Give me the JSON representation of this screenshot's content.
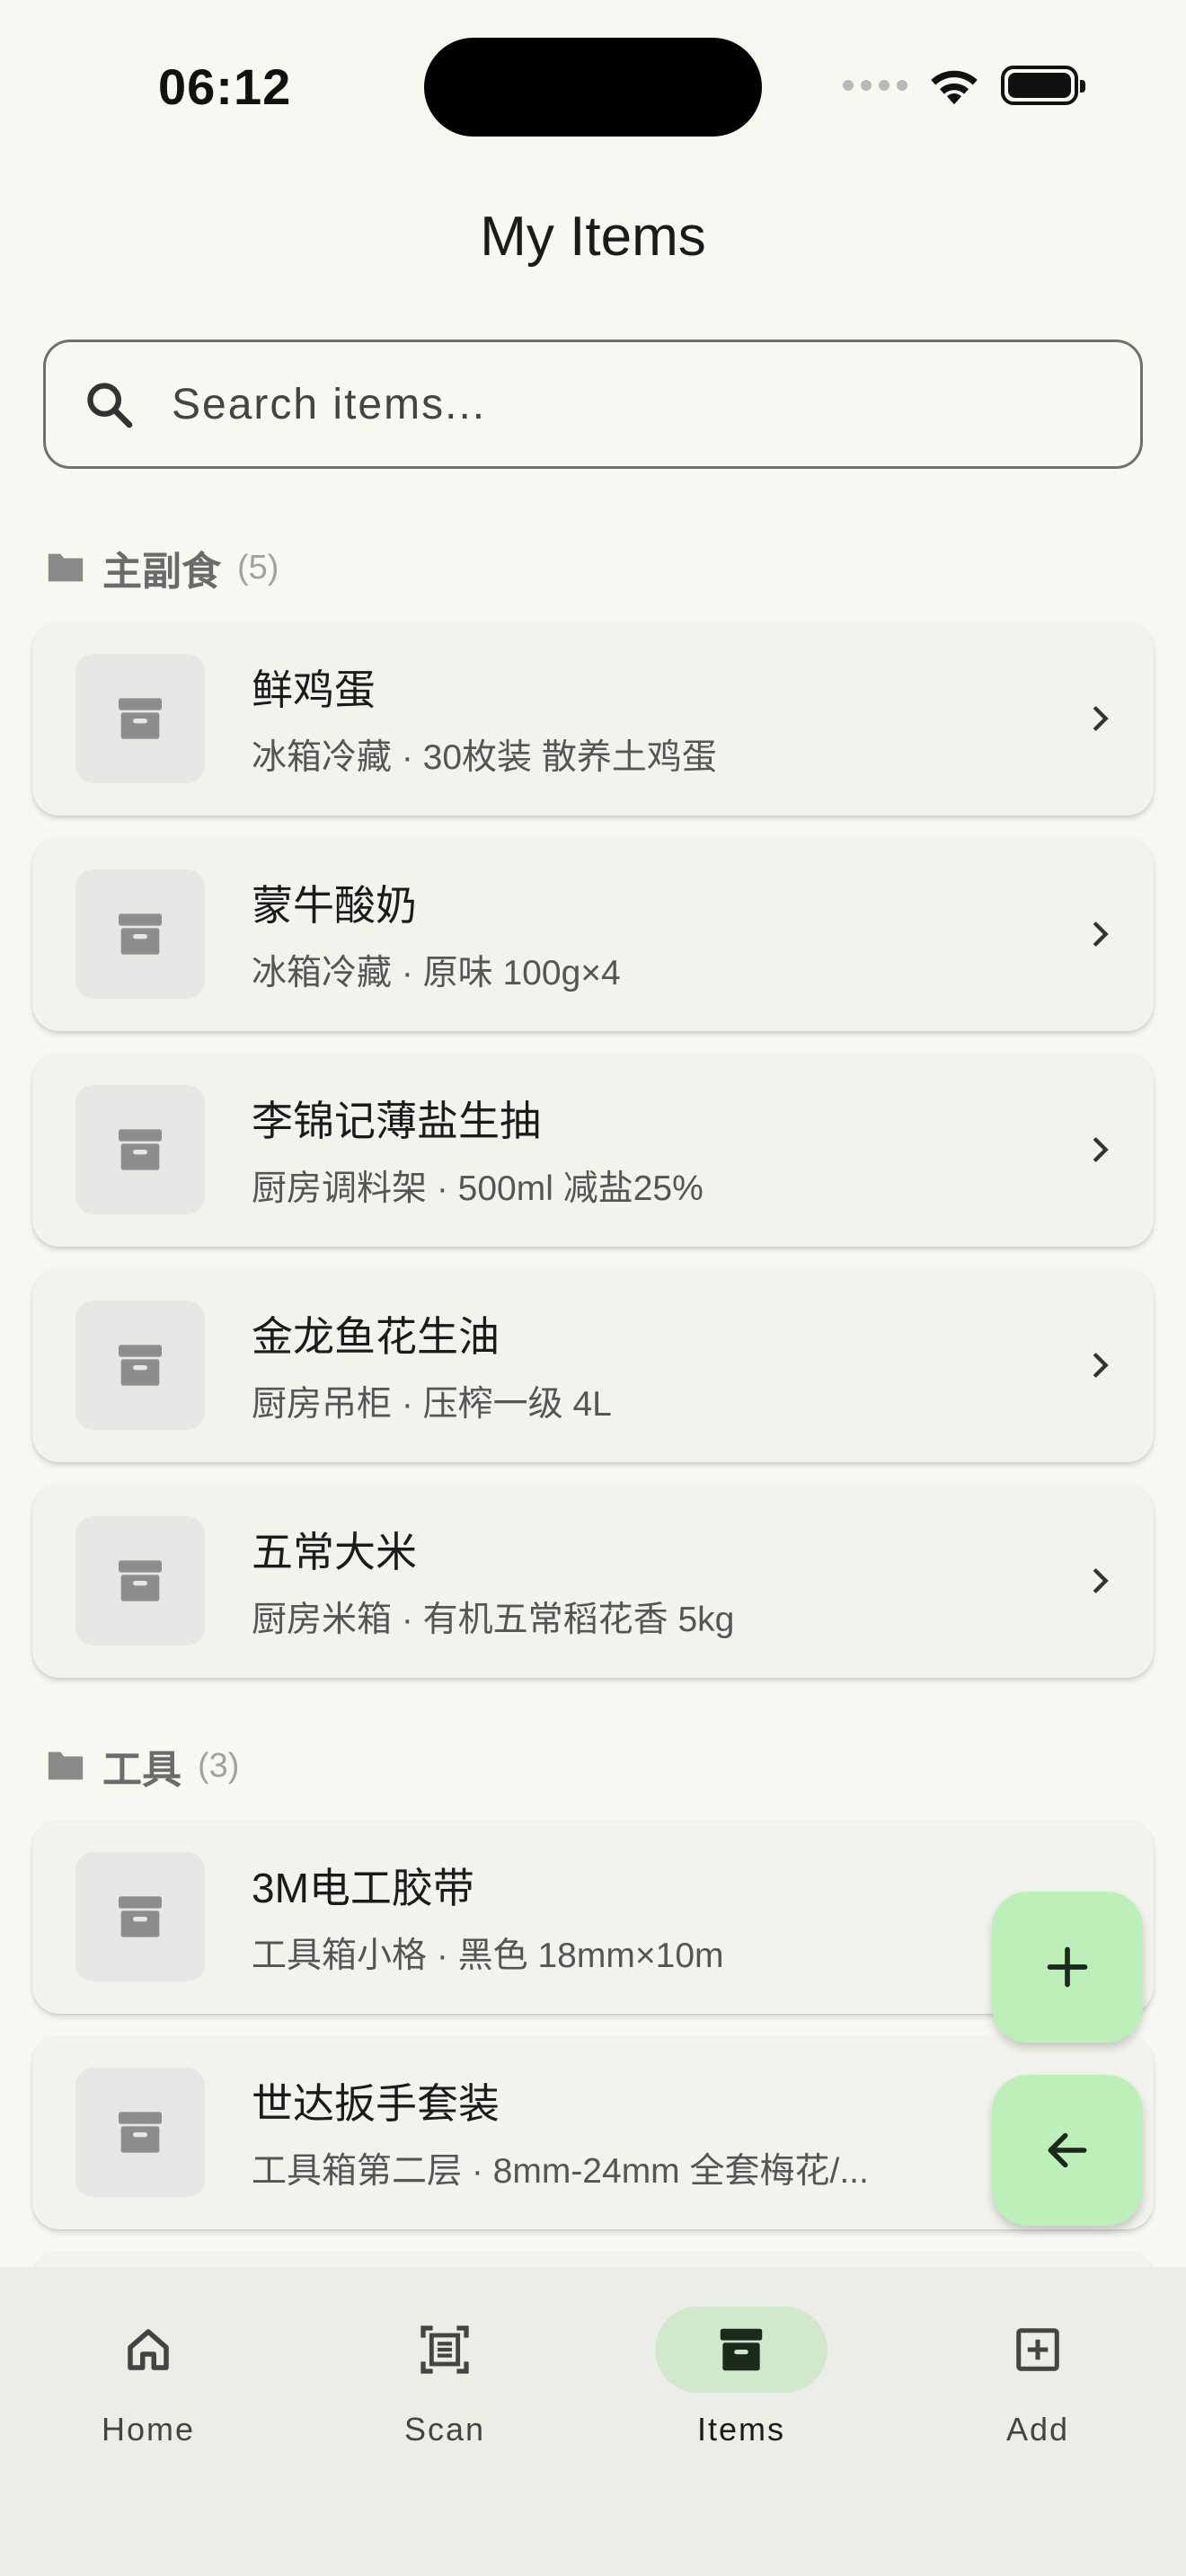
{
  "status_bar": {
    "time": "06:12"
  },
  "header": {
    "title": "My Items"
  },
  "search": {
    "placeholder": "Search items..."
  },
  "sections": [
    {
      "name": "主副食",
      "count": "(5)",
      "items": [
        {
          "name": "鲜鸡蛋",
          "desc": "冰箱冷藏 · 30枚装 散养土鸡蛋"
        },
        {
          "name": "蒙牛酸奶",
          "desc": "冰箱冷藏 · 原味 100g×4"
        },
        {
          "name": "李锦记薄盐生抽",
          "desc": "厨房调料架 · 500ml 减盐25%"
        },
        {
          "name": "金龙鱼花生油",
          "desc": "厨房吊柜 · 压榨一级 4L"
        },
        {
          "name": "五常大米",
          "desc": "厨房米箱 · 有机五常稻花香 5kg"
        }
      ]
    },
    {
      "name": "工具",
      "count": "(3)",
      "items": [
        {
          "name": "3M电工胶带",
          "desc": "工具箱小格 · 黑色 18mm×10m"
        },
        {
          "name": "世达扳手套装",
          "desc": "工具箱第二层 · 8mm-24mm 全套梅花/..."
        }
      ]
    }
  ],
  "bottom_nav": [
    {
      "label": "Home",
      "icon": "home-icon",
      "active": false
    },
    {
      "label": "Scan",
      "icon": "scan-icon",
      "active": false
    },
    {
      "label": "Items",
      "icon": "archive-icon",
      "active": true
    },
    {
      "label": "Add",
      "icon": "add-box-icon",
      "active": false
    }
  ],
  "colors": {
    "background": "#f6f8f1",
    "fab": "#bdf0b9",
    "nav_active_pill": "#d2e8cd",
    "card": "#f2f3ec"
  }
}
